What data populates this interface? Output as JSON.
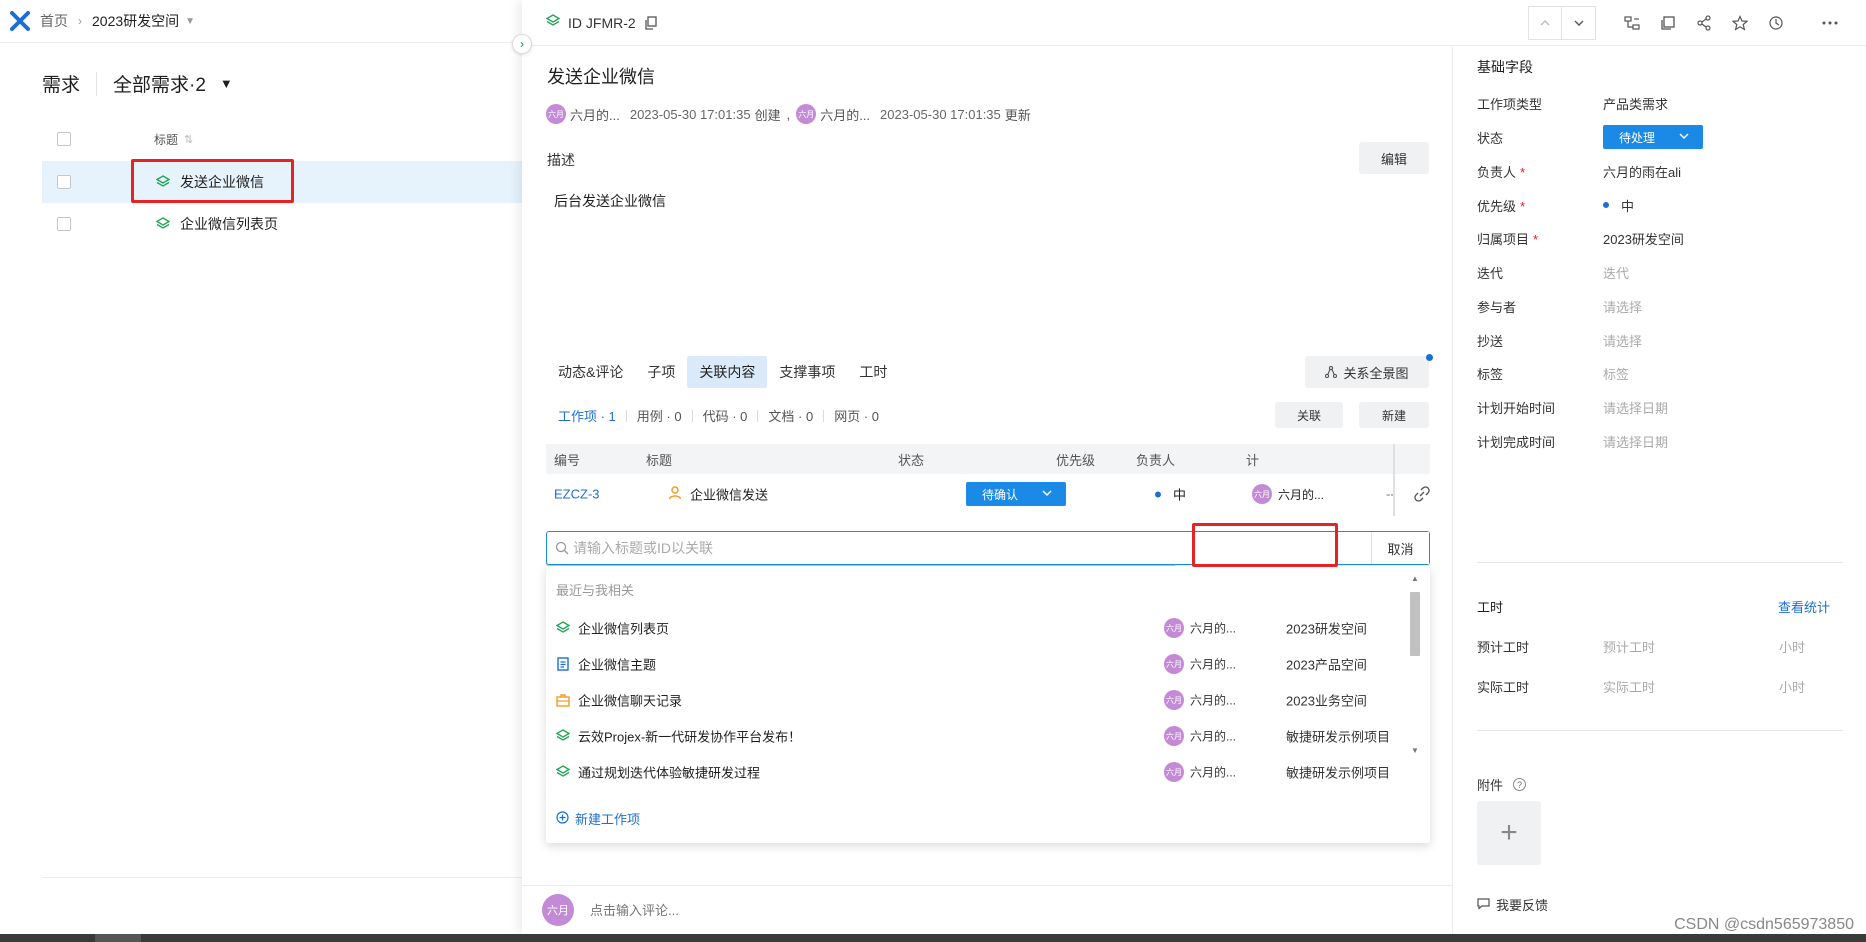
{
  "breadcrumb": {
    "home": "首页",
    "project": "2023研发空间"
  },
  "view": {
    "title": "需求",
    "filter": "全部需求·2"
  },
  "list": {
    "title_header": "标题",
    "items": [
      {
        "title": "发送企业微信"
      },
      {
        "title": "企业微信列表页"
      }
    ]
  },
  "drawer": {
    "id_label": "ID JFMR-2",
    "title": "发送企业微信",
    "meta": {
      "creator": "六月的...",
      "created_at": "2023-05-30 17:01:35",
      "created_action": "创建",
      "updater": "六月的...",
      "updated_at": "2023-05-30 17:01:35",
      "updated_action": "更新",
      "avatar_text": "六月"
    },
    "description_label": "描述",
    "edit_label": "编辑",
    "description_text": "后台发送企业微信",
    "tabs": [
      "动态&评论",
      "子项",
      "关联内容",
      "支撑事项",
      "工时"
    ],
    "relation_map_label": "关系全景图",
    "subtabs": [
      "工作项 · 1",
      "用例 · 0",
      "代码 · 0",
      "文档 · 0",
      "网页 · 0"
    ],
    "link_label": "关联",
    "new_label": "新建",
    "table": {
      "headers": [
        "编号",
        "标题",
        "状态",
        "优先级",
        "负责人",
        "计"
      ],
      "row": {
        "id": "EZCZ-3",
        "title": "企业微信发送",
        "status": "待确认",
        "priority": "中",
        "owner": "六月的...",
        "plan": "--",
        "avatar_text": "六月"
      }
    },
    "search": {
      "placeholder": "请输入标题或ID以关联",
      "cancel": "取消"
    },
    "dropdown": {
      "section": "最近与我相关",
      "items": [
        {
          "title": "企业微信列表页",
          "owner": "六月的...",
          "project": "2023研发空间",
          "icon": "layers-icon"
        },
        {
          "title": "企业微信主题",
          "owner": "六月的...",
          "project": "2023产品空间",
          "icon": "doc-icon"
        },
        {
          "title": "企业微信聊天记录",
          "owner": "六月的...",
          "project": "2023业务空间",
          "icon": "briefcase-icon"
        },
        {
          "title": "云效Projex-新一代研发协作平台发布！",
          "owner": "六月的...",
          "project": "敏捷研发示例项目",
          "icon": "layers-icon"
        },
        {
          "title": "通过规划迭代体验敏捷研发过程",
          "owner": "六月的...",
          "project": "敏捷研发示例项目",
          "icon": "layers-icon"
        }
      ],
      "new_item": "新建工作项",
      "avatar_text": "六月"
    },
    "comment": {
      "avatar_text": "六月",
      "placeholder": "点击输入评论..."
    }
  },
  "fields": {
    "section": "基础字段",
    "rows": [
      {
        "label": "工作项类型",
        "value": "产品类需求"
      },
      {
        "label": "状态",
        "value": "待处理"
      },
      {
        "label": "负责人",
        "value": "六月的雨在ali",
        "required": "*"
      },
      {
        "label": "优先级",
        "value": "中",
        "required": "*"
      },
      {
        "label": "归属项目",
        "value": "2023研发空间",
        "required": "*"
      },
      {
        "label": "迭代",
        "placeholder": "迭代"
      },
      {
        "label": "参与者",
        "placeholder": "请选择"
      },
      {
        "label": "抄送",
        "placeholder": "请选择"
      },
      {
        "label": "标签",
        "placeholder": "标签"
      },
      {
        "label": "计划开始时间",
        "placeholder": "请选择日期"
      },
      {
        "label": "计划完成时间",
        "placeholder": "请选择日期"
      }
    ],
    "hours": {
      "section": "工时",
      "view_stats": "查看统计",
      "estimated_label": "预计工时",
      "estimated_placeholder": "预计工时",
      "actual_label": "实际工时",
      "actual_placeholder": "实际工时",
      "unit": "小时"
    },
    "attachments": {
      "label": "附件",
      "add": "+"
    },
    "feedback": "我要反馈"
  },
  "watermark": "CSDN @csdn565973850",
  "colors": {
    "accent": "#1b6fd3",
    "status": "#1b8ae6",
    "highlight_box": "#e62323",
    "avatar": "#c38ad6",
    "layers_icon": "#25a35a",
    "doc_icon": "#1b6fd3",
    "briefcase_icon": "#f59a23",
    "user_icon": "#f59a23"
  }
}
